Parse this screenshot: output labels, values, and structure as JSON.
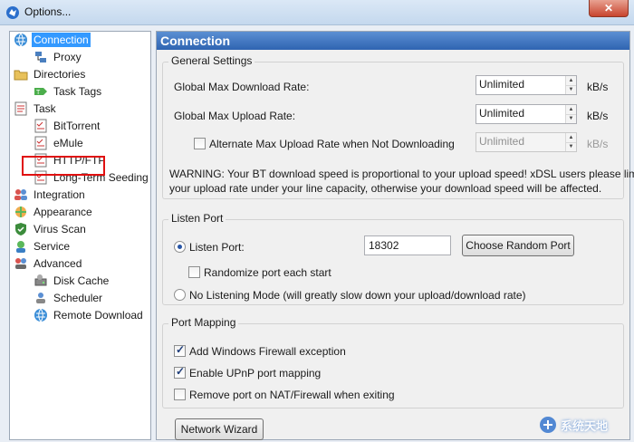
{
  "window": {
    "title": "Options..."
  },
  "sidebar": {
    "items": [
      {
        "label": "Connection",
        "icon": "globe-icon"
      },
      {
        "label": "Proxy",
        "icon": "network-icon"
      },
      {
        "label": "Directories",
        "icon": "folder-icon"
      },
      {
        "label": "Task Tags",
        "icon": "tag-icon"
      },
      {
        "label": "Task",
        "icon": "task-icon"
      },
      {
        "label": "BitTorrent",
        "icon": "checklist-icon"
      },
      {
        "label": "eMule",
        "icon": "checklist-icon"
      },
      {
        "label": "HTTP/FTP",
        "icon": "checklist-icon"
      },
      {
        "label": "Long-Term Seeding",
        "icon": "checklist-icon"
      },
      {
        "label": "Integration",
        "icon": "users-icon"
      },
      {
        "label": "Appearance",
        "icon": "appearance-icon"
      },
      {
        "label": "Virus Scan",
        "icon": "shield-icon"
      },
      {
        "label": "Service",
        "icon": "service-icon"
      },
      {
        "label": "Advanced",
        "icon": "advanced-icon"
      },
      {
        "label": "Disk Cache",
        "icon": "disk-icon"
      },
      {
        "label": "Scheduler",
        "icon": "scheduler-icon"
      },
      {
        "label": "Remote Download",
        "icon": "globe-icon"
      }
    ],
    "selected": "Connection",
    "highlighted": "eMule"
  },
  "content": {
    "header": "Connection",
    "general": {
      "title": "General Settings",
      "download_label": "Global Max Download Rate:",
      "download_value": "Unlimited",
      "download_unit": "kB/s",
      "upload_label": "Global Max Upload Rate:",
      "upload_value": "Unlimited",
      "upload_unit": "kB/s",
      "alt_label": "Alternate Max Upload Rate when Not Downloading",
      "alt_value": "Unlimited",
      "alt_unit": "kB/s",
      "warning_line1": "WARNING: Your BT download speed is proportional to your upload speed! xDSL users please limit",
      "warning_line2": "your upload rate under your line capacity, otherwise your download speed will be affected."
    },
    "listen": {
      "title": "Listen Port",
      "port_label": "Listen Port:",
      "port_value": "18302",
      "random_button": "Choose Random Port",
      "randomize_label": "Randomize port each start",
      "no_listen_label": "No Listening Mode (will greatly slow down your upload/download rate)"
    },
    "mapping": {
      "title": "Port Mapping",
      "firewall_label": "Add Windows Firewall exception",
      "upnp_label": "Enable UPnP port mapping",
      "remove_label": "Remove port on NAT/Firewall when exiting"
    },
    "wizard_button": "Network Wizard"
  },
  "watermark": {
    "text": "系统天地"
  },
  "colors": {
    "header_blue": "#3a6fbe",
    "selection": "#3399ff",
    "highlight_box": "#e01010"
  }
}
